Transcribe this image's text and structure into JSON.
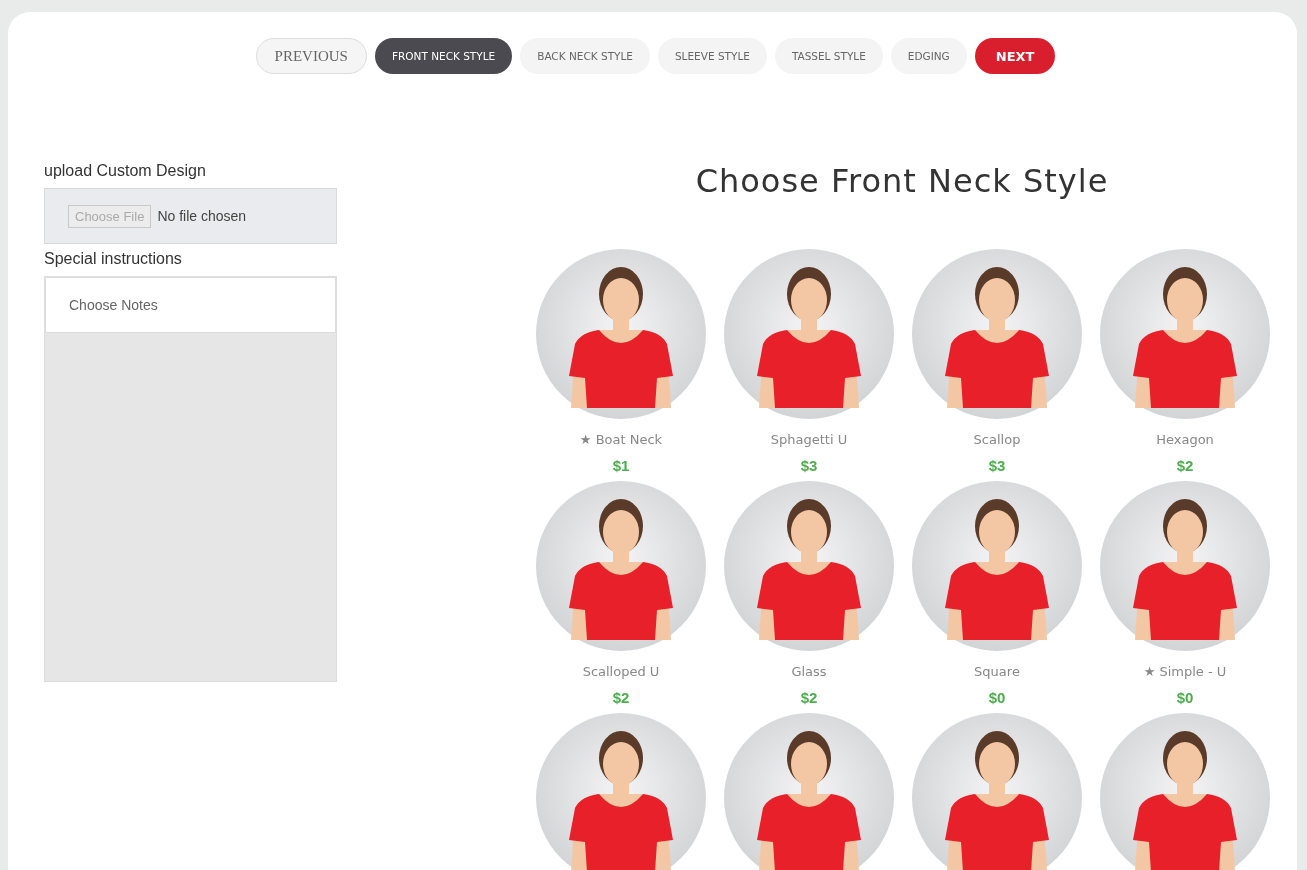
{
  "steps": {
    "previous": "PREVIOUS",
    "tabs": [
      {
        "label": "FRONT NECK STYLE",
        "selected": true
      },
      {
        "label": "BACK NECK STYLE",
        "selected": false
      },
      {
        "label": "SLEEVE STYLE",
        "selected": false
      },
      {
        "label": "TASSEL STYLE",
        "selected": false
      },
      {
        "label": "EDGING",
        "selected": false
      }
    ],
    "next": "NEXT"
  },
  "upload": {
    "label": "upload Custom Design",
    "button": "Choose File",
    "status": "No file chosen"
  },
  "instructions": {
    "label": "Special instructions",
    "placeholder": "Choose Notes"
  },
  "heading": "Choose Front Neck Style",
  "styles": [
    {
      "kind": "labeled",
      "name": "★ Boat Neck",
      "price": "$1"
    },
    {
      "kind": "labeled",
      "name": "Sphagetti U",
      "price": "$3"
    },
    {
      "kind": "labeled",
      "name": "Scallop",
      "price": "$3"
    },
    {
      "kind": "labeled",
      "name": "Hexagon",
      "price": "$2"
    },
    {
      "kind": "labeled",
      "name": "Scalloped U",
      "price": "$2"
    },
    {
      "kind": "labeled",
      "name": "Glass",
      "price": "$2"
    },
    {
      "kind": "labeled",
      "name": "Square",
      "price": "$0"
    },
    {
      "kind": "labeled",
      "name": "★ Simple - U",
      "price": "$0"
    },
    {
      "kind": "cut"
    },
    {
      "kind": "cut"
    },
    {
      "kind": "cut"
    },
    {
      "kind": "cut"
    }
  ]
}
